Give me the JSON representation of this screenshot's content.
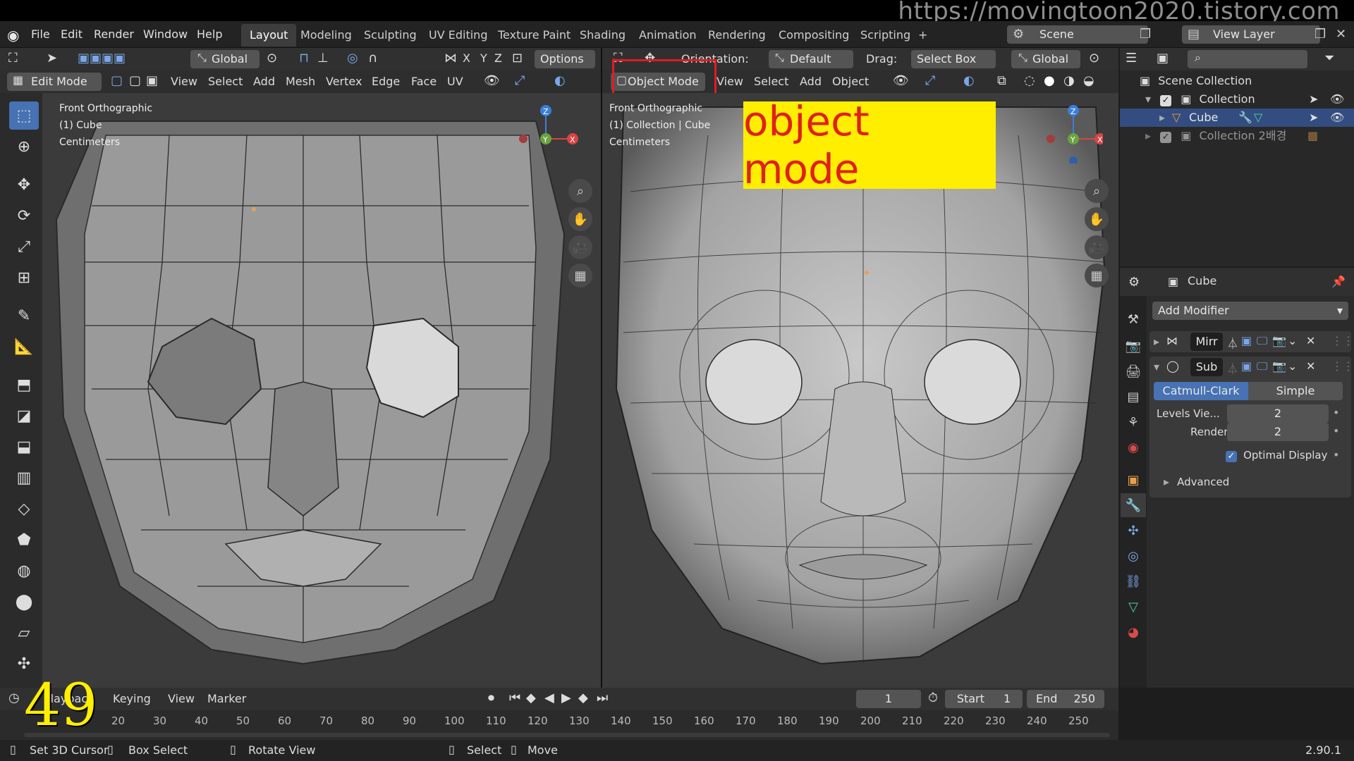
{
  "watermark": "https://movingtoon2020.tistory.com",
  "menu": [
    "File",
    "Edit",
    "Render",
    "Window",
    "Help"
  ],
  "workspaces": [
    "Layout",
    "Modeling",
    "Sculpting",
    "UV Editing",
    "Texture Paint",
    "Shading",
    "Animation",
    "Rendering",
    "Compositing",
    "Scripting"
  ],
  "active_workspace": "Layout",
  "add_workspace": "+",
  "scene": {
    "label": "Scene",
    "view_layer": "View Layer"
  },
  "left_view": {
    "orientation": "Global",
    "axes": [
      "X",
      "Y",
      "Z"
    ],
    "options": "Options",
    "mode": "Edit Mode",
    "menus": [
      "View",
      "Select",
      "Add",
      "Mesh",
      "Vertex",
      "Edge",
      "Face",
      "UV"
    ],
    "overlay": [
      "Front Orthographic",
      "(1) Cube",
      "Centimeters"
    ]
  },
  "right_view": {
    "orientation_label": "Orientation:",
    "orientation": "Default",
    "drag_label": "Drag:",
    "drag": "Select Box",
    "transform": "Global",
    "mode": "Object Mode",
    "menus": [
      "View",
      "Select",
      "Add",
      "Object"
    ],
    "overlay": [
      "Front Orthographic",
      "(1) Collection | Cube",
      "Centimeters"
    ],
    "callout": "object mode",
    "callout_bg": "#ffee00",
    "callout_fg": "#e0201e",
    "highlight": "#e21b22"
  },
  "outliner": {
    "root": "Scene Collection",
    "items": [
      {
        "label": "Collection"
      },
      {
        "label": "Cube",
        "selected": true
      },
      {
        "label": "Collection 2배경"
      }
    ]
  },
  "properties": {
    "object": "Cube",
    "add_modifier": "Add Modifier",
    "modifiers": [
      {
        "name": "Mirr"
      },
      {
        "name": "Sub"
      }
    ],
    "subdiv_types": [
      "Catmull-Clark",
      "Simple"
    ],
    "levels_label": "Levels Vie...",
    "levels_value": "2",
    "render_label": "Render",
    "render_value": "2",
    "optimal_display": "Optimal Display",
    "advanced": "Advanced"
  },
  "timeline": {
    "playback": "Playback",
    "keying": "Keying",
    "view": "View",
    "marker": "Marker",
    "current_frame": "1",
    "start_label": "Start",
    "start": "1",
    "end_label": "End",
    "end": "250",
    "ticks": [
      "20",
      "30",
      "40",
      "50",
      "60",
      "70",
      "80",
      "90",
      "100",
      "110",
      "120",
      "130",
      "140",
      "150",
      "160",
      "170",
      "180",
      "190",
      "200",
      "210",
      "220",
      "230",
      "240",
      "250"
    ],
    "overlay_number": "49"
  },
  "statusbar": {
    "items": [
      "Set 3D Cursor",
      "Box Select",
      "Rotate View",
      "Select",
      "Move"
    ],
    "version": "2.90.1"
  },
  "colors": {
    "accent": "#4772b3",
    "header": "#303030",
    "viewport": "#3b3b3b"
  }
}
